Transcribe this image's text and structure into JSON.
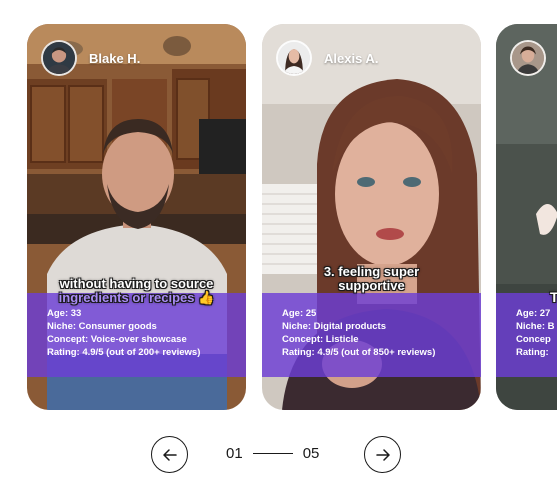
{
  "cards": [
    {
      "creator": "Blake H.",
      "caption_line1": "without having to source",
      "caption_line2": "ingredients or recipes",
      "caption_emoji": "👍",
      "age": "Age: 33",
      "niche": "Niche: Consumer goods",
      "concept": "Concept: Voice-over showcase",
      "rating": "Rating: 4.9/5 (out of 200+ reviews)"
    },
    {
      "creator": "Alexis A.",
      "caption_line1": "3. feeling super",
      "caption_line2": "supportive",
      "age": "Age: 25",
      "niche": "Niche: Digital products",
      "concept": "Concept: Listicle",
      "rating": "Rating: 4.9/5 (out of 850+ reviews)"
    },
    {
      "creator": "",
      "caption_line1": "T",
      "age": "Age: 27",
      "niche": "Niche: B",
      "concept": "Concep",
      "rating": "Rating:"
    }
  ],
  "pagination": {
    "current": "01",
    "total": "05",
    "prev_icon": "arrow-left-icon",
    "next_icon": "arrow-right-icon"
  },
  "colors": {
    "accent": "#6c3ed6",
    "caption_highlight": "#a98cf5"
  }
}
